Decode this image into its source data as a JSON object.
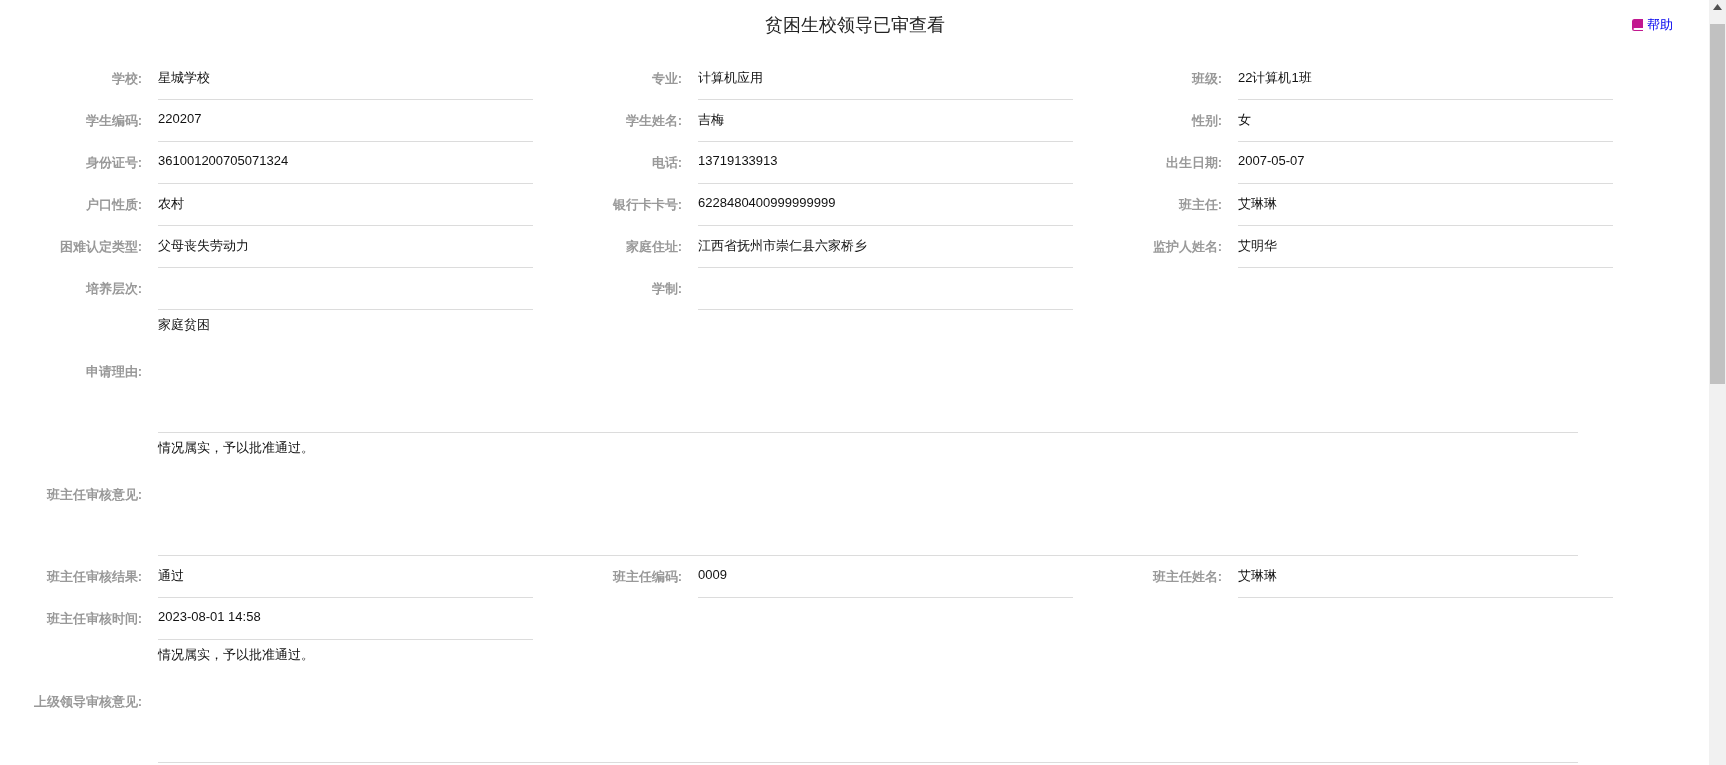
{
  "title": "贫困生校领导已审查看",
  "help": {
    "label": "帮助"
  },
  "rows": [
    {
      "kind": "grid",
      "fields": [
        {
          "label": "学校:",
          "value": "星城学校"
        },
        {
          "label": "专业:",
          "value": "计算机应用"
        },
        {
          "label": "班级:",
          "value": "22计算机1班"
        }
      ]
    },
    {
      "kind": "grid",
      "fields": [
        {
          "label": "学生编码:",
          "value": "220207"
        },
        {
          "label": "学生姓名:",
          "value": "吉梅"
        },
        {
          "label": "性别:",
          "value": "女"
        }
      ]
    },
    {
      "kind": "grid",
      "fields": [
        {
          "label": "身份证号:",
          "value": "361001200705071324"
        },
        {
          "label": "电话:",
          "value": "13719133913"
        },
        {
          "label": "出生日期:",
          "value": "2007-05-07"
        }
      ]
    },
    {
      "kind": "grid",
      "fields": [
        {
          "label": "户口性质:",
          "value": "农村"
        },
        {
          "label": "银行卡卡号:",
          "value": "6228480400999999999"
        },
        {
          "label": "班主任:",
          "value": "艾琳琳"
        }
      ]
    },
    {
      "kind": "grid",
      "fields": [
        {
          "label": "困难认定类型:",
          "value": "父母丧失劳动力"
        },
        {
          "label": "家庭住址:",
          "value": "江西省抚州市崇仁县六家桥乡"
        },
        {
          "label": "监护人姓名:",
          "value": "艾明华"
        }
      ]
    },
    {
      "kind": "grid",
      "fields": [
        {
          "label": "培养层次:"
        },
        {
          "label": "学制:"
        }
      ]
    },
    {
      "kind": "long",
      "fields": [
        {
          "label": "申请理由:",
          "value": "家庭贫困"
        }
      ]
    },
    {
      "kind": "long",
      "fields": [
        {
          "label": "班主任审核意见:",
          "value": "情况属实，予以批准通过。"
        }
      ]
    },
    {
      "kind": "grid",
      "fields": [
        {
          "label": "班主任审核结果:",
          "value": "通过"
        },
        {
          "label": "班主任编码:",
          "value": "0009"
        },
        {
          "label": "班主任姓名:",
          "value": "艾琳琳"
        }
      ]
    },
    {
      "kind": "grid",
      "fields": [
        {
          "label": "班主任审核时间:",
          "value": "2023-08-01 14:58"
        }
      ]
    },
    {
      "kind": "long",
      "fields": [
        {
          "label": "上级领导审核意见:",
          "value": "情况属实，予以批准通过。"
        }
      ]
    }
  ]
}
